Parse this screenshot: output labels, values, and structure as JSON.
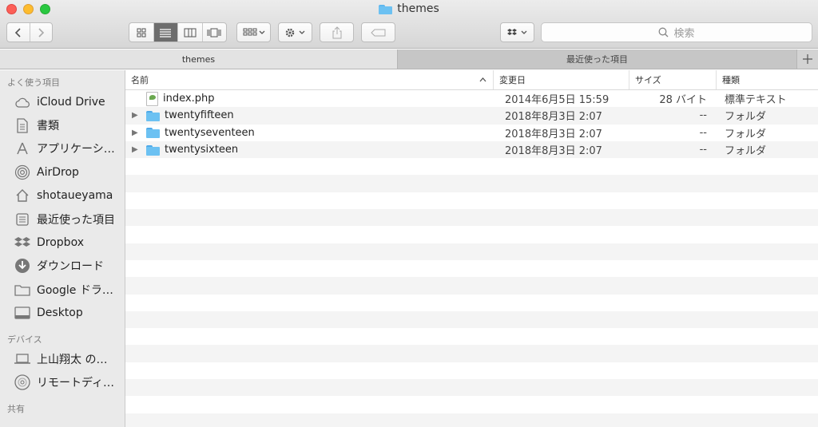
{
  "window": {
    "title": "themes"
  },
  "toolbar": {
    "search_placeholder": "検索"
  },
  "tabs": [
    {
      "label": "themes"
    },
    {
      "label": "最近使った項目"
    }
  ],
  "sidebar": {
    "favorites_header": "よく使う項目",
    "favorites": [
      {
        "label": "iCloud Drive",
        "icon": "cloud-icon"
      },
      {
        "label": "書類",
        "icon": "document-icon"
      },
      {
        "label": "アプリケーシ…",
        "icon": "applications-icon"
      },
      {
        "label": "AirDrop",
        "icon": "airdrop-icon"
      },
      {
        "label": "shotaueyama",
        "icon": "home-icon"
      },
      {
        "label": "最近使った項目",
        "icon": "recents-icon"
      },
      {
        "label": "Dropbox",
        "icon": "dropbox-icon"
      },
      {
        "label": "ダウンロード",
        "icon": "download-icon"
      },
      {
        "label": "Google ドラ…",
        "icon": "folder-icon"
      },
      {
        "label": "Desktop",
        "icon": "desktop-icon"
      }
    ],
    "devices_header": "デバイス",
    "devices": [
      {
        "label": "上山翔太 の…",
        "icon": "laptop-icon"
      },
      {
        "label": "リモートディ…",
        "icon": "disc-icon"
      }
    ],
    "shared_header": "共有"
  },
  "columns": {
    "name": "名前",
    "date": "変更日",
    "size": "サイズ",
    "kind": "種類"
  },
  "files": [
    {
      "name": "index.php",
      "date": "2014年6月5日 15:59",
      "size": "28 バイト",
      "kind": "標準テキスト",
      "type": "file"
    },
    {
      "name": "twentyfifteen",
      "date": "2018年8月3日 2:07",
      "size": "--",
      "kind": "フォルダ",
      "type": "folder"
    },
    {
      "name": "twentyseventeen",
      "date": "2018年8月3日 2:07",
      "size": "--",
      "kind": "フォルダ",
      "type": "folder"
    },
    {
      "name": "twentysixteen",
      "date": "2018年8月3日 2:07",
      "size": "--",
      "kind": "フォルダ",
      "type": "folder"
    }
  ]
}
